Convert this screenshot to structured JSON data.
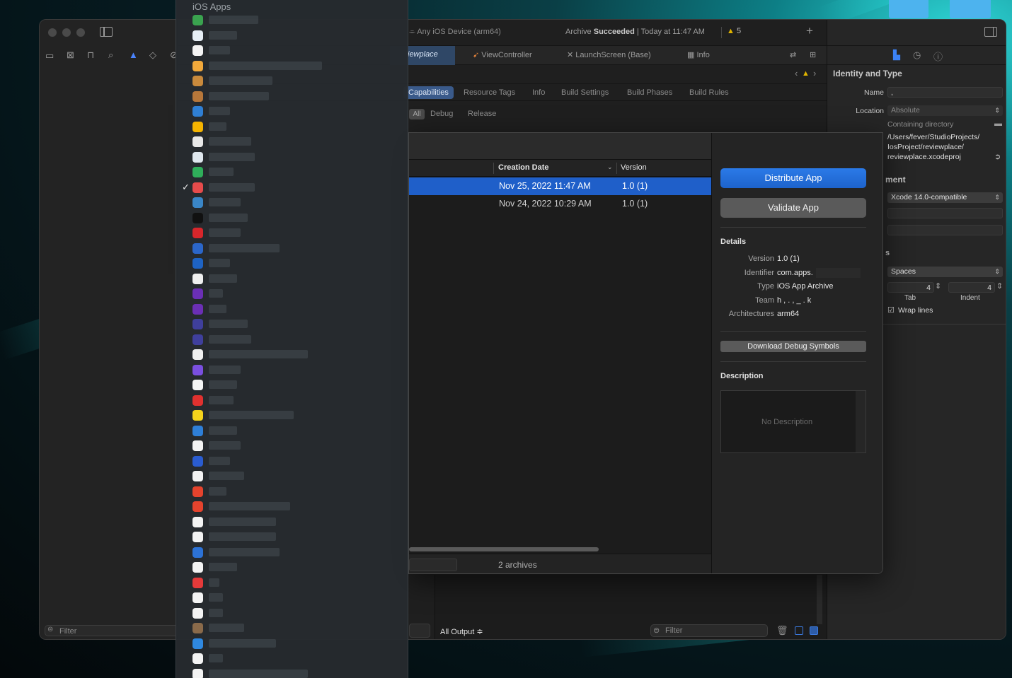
{
  "applist": {
    "title": "iOS Apps",
    "items": [
      {
        "color": "#3aa34f",
        "checked": false
      },
      {
        "color": "#e6eef5",
        "checked": false
      },
      {
        "color": "#f3f3f3",
        "checked": false
      },
      {
        "color": "#f2a93b",
        "checked": false
      },
      {
        "color": "#c98a3c",
        "checked": false
      },
      {
        "color": "#b7773a",
        "checked": false
      },
      {
        "color": "#2f7fd4",
        "checked": false
      },
      {
        "color": "#f5b400",
        "checked": false
      },
      {
        "color": "#e8e8e8",
        "checked": false
      },
      {
        "color": "#dfe7ee",
        "checked": false
      },
      {
        "color": "#2fae5a",
        "checked": false
      },
      {
        "color": "#e64b4b",
        "checked": true
      },
      {
        "color": "#3a86c7",
        "checked": false
      },
      {
        "color": "#111111",
        "checked": false
      },
      {
        "color": "#d8262b",
        "checked": false
      },
      {
        "color": "#2b66c9",
        "checked": false
      },
      {
        "color": "#1e63c4",
        "checked": false
      },
      {
        "color": "#efefef",
        "checked": false
      },
      {
        "color": "#6b2fb5",
        "checked": false
      },
      {
        "color": "#6b2fb5",
        "checked": false
      },
      {
        "color": "#3f3f9c",
        "checked": false
      },
      {
        "color": "#3f3f9c",
        "checked": false
      },
      {
        "color": "#efefef",
        "checked": false
      },
      {
        "color": "#7a4fe0",
        "checked": false
      },
      {
        "color": "#f5f5f5",
        "checked": false
      },
      {
        "color": "#e0312f",
        "checked": false
      },
      {
        "color": "#f5d31c",
        "checked": false
      },
      {
        "color": "#2e7fd8",
        "checked": false
      },
      {
        "color": "#f3f3f3",
        "checked": false
      },
      {
        "color": "#2a5cd0",
        "checked": false
      },
      {
        "color": "#f3f3f3",
        "checked": false
      },
      {
        "color": "#e5432d",
        "checked": false
      },
      {
        "color": "#e5432d",
        "checked": false
      },
      {
        "color": "#f3f3f3",
        "checked": false
      },
      {
        "color": "#f3f3f3",
        "checked": false
      },
      {
        "color": "#2c72d6",
        "checked": false
      },
      {
        "color": "#f3f3f3",
        "checked": false
      },
      {
        "color": "#e63a3a",
        "checked": false
      },
      {
        "color": "#f3f3f3",
        "checked": false
      },
      {
        "color": "#f3f3f3",
        "checked": false
      },
      {
        "color": "#8a6a4a",
        "checked": false
      },
      {
        "color": "#2f88e0",
        "checked": false
      },
      {
        "color": "#f3f3f3",
        "checked": false
      },
      {
        "color": "#f3f3f3",
        "checked": false
      }
    ]
  },
  "toolbar": {
    "scheme": "Any iOS Device (arm64)",
    "status_prefix": "Archive ",
    "status_bold": "Succeeded",
    "status_time": " | Today at 11:47 AM",
    "warnings": "5",
    "add": "+"
  },
  "tabs": {
    "project": "iewplace",
    "viewcontroller": "ViewController",
    "launchscreen": "LaunchScreen (Base)",
    "info": "Info"
  },
  "settings_tabs": [
    "Capabilities",
    "Resource Tags",
    "Info",
    "Build Settings",
    "Build Phases",
    "Build Rules"
  ],
  "config_tabs": [
    "All",
    "Debug",
    "Release"
  ],
  "organizer": {
    "col_creation": "Creation Date",
    "col_version": "Version",
    "rows": [
      {
        "date": "Nov 25, 2022 11:47 AM",
        "version": "1.0 (1)",
        "selected": true
      },
      {
        "date": "Nov 24, 2022 10:29 AM",
        "version": "1.0 (1)",
        "selected": false
      }
    ],
    "archives_count": "2 archives",
    "distribute": "Distribute App",
    "validate": "Validate App",
    "details_title": "Details",
    "details": [
      {
        "label": "Version",
        "value": "1.0 (1)"
      },
      {
        "label": "Identifier",
        "value": "com.apps."
      },
      {
        "label": "Type",
        "value": "iOS App Archive"
      },
      {
        "label": "Team",
        "value": "h ,  .  ,  _  .  k"
      },
      {
        "label": "Architectures",
        "value": "arm64"
      }
    ],
    "download_symbols": "Download Debug Symbols",
    "description_title": "Description",
    "description_placeholder": "No Description"
  },
  "inspector": {
    "section_title": "Identity and Type",
    "name_label": "Name",
    "name_value": "   ,",
    "location_label": "Location",
    "location_value": "Absolute",
    "containing": "Containing directory",
    "path_line1": "/Users/fever/StudioProjects/",
    "path_line2": "IosProject/reviewplace/",
    "path_line3": "reviewplace.xcodeproj",
    "doc_section": "ment",
    "xcode_compat": "Xcode 14.0-compatible",
    "indent_section": "s",
    "indent_using": "Spaces",
    "tab_value": "4",
    "indent_value": "4",
    "tab_label": "Tab",
    "indent_label": "Indent",
    "wrap_label": "Wrap lines"
  },
  "bottom": {
    "nav_filter": "Filter",
    "output": "All Output ≑",
    "debug_filter": "Filter"
  }
}
